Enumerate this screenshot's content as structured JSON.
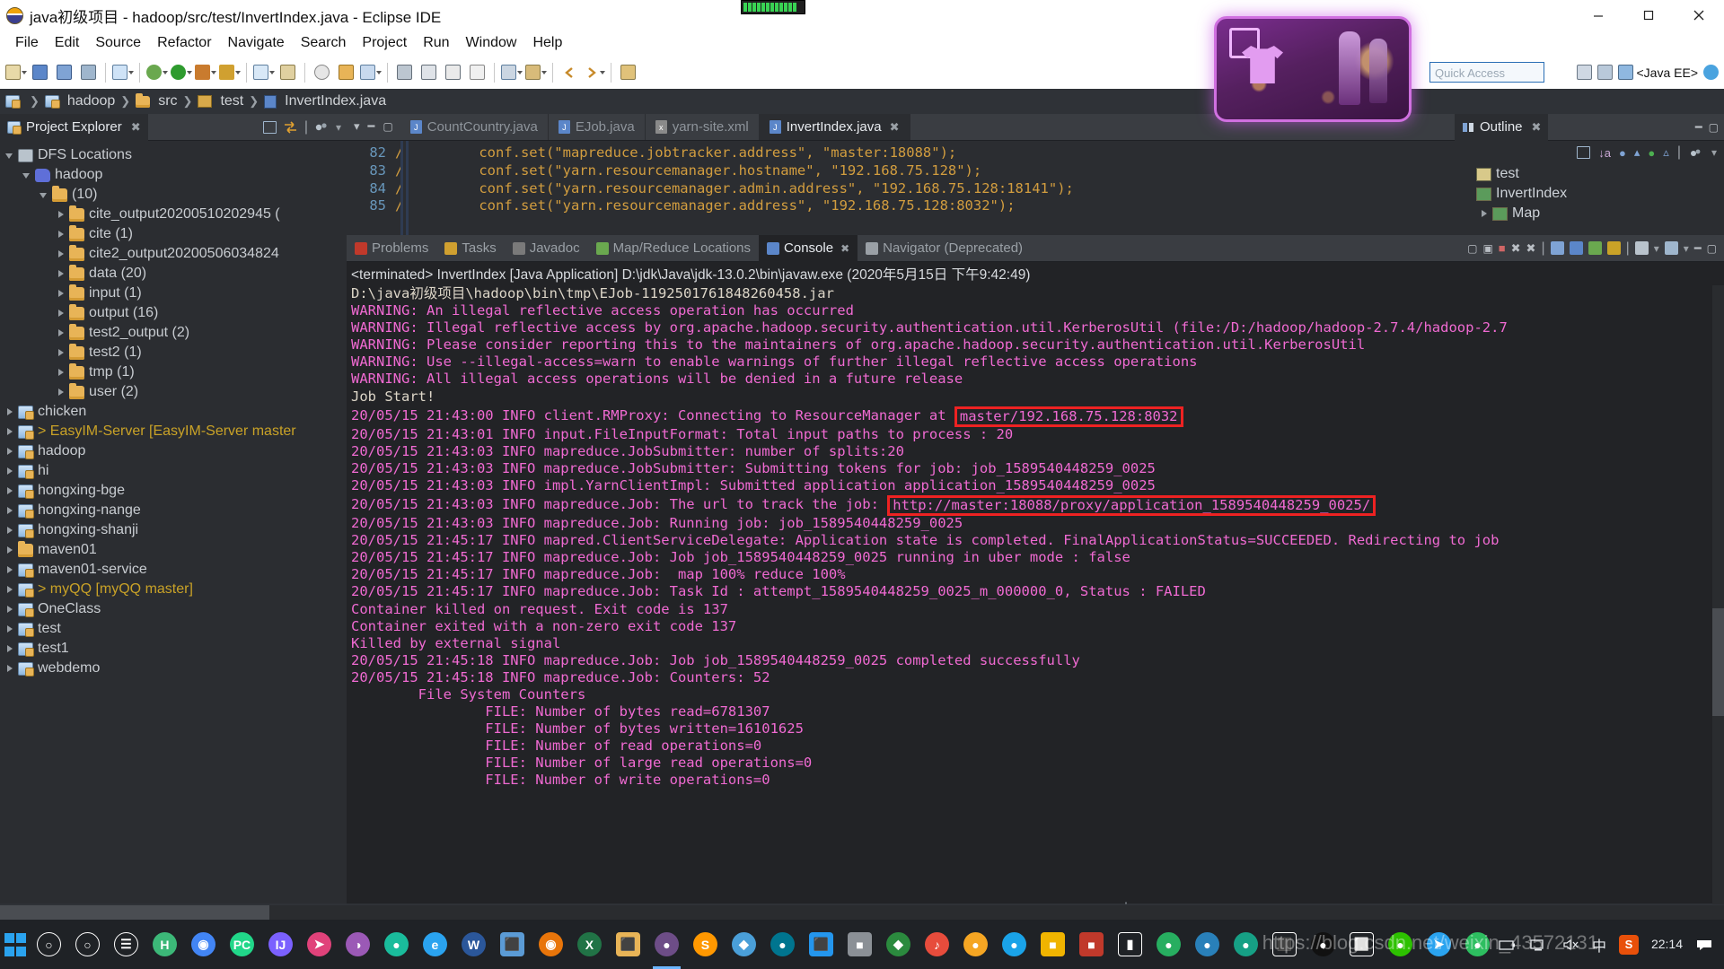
{
  "window": {
    "title": "java初级项目 - hadoop/src/test/InvertIndex.java - Eclipse IDE",
    "app_icon": "eclipse-icon",
    "minimize": "—",
    "maximize": "❐",
    "close": "✕"
  },
  "menubar": {
    "items": [
      "File",
      "Edit",
      "Source",
      "Refactor",
      "Navigate",
      "Search",
      "Project",
      "Run",
      "Window",
      "Help"
    ]
  },
  "toolbar": {
    "quick_access_placeholder": "Quick Access",
    "perspective_label": "<Java EE>"
  },
  "breadcrumb": {
    "items": [
      "hadoop",
      "src",
      "test",
      "InvertIndex.java"
    ]
  },
  "project_explorer": {
    "tab_label": "Project Explorer",
    "tree": [
      {
        "label": "DFS Locations",
        "indent": 0,
        "arrow": "open",
        "icon": "dfs-icon",
        "style": "folder"
      },
      {
        "label": "hadoop",
        "indent": 1,
        "arrow": "open",
        "icon": "elephant-icon",
        "style": "folder"
      },
      {
        "label": "(10)",
        "indent": 2,
        "arrow": "open",
        "icon": "folder-icon",
        "style": "folder"
      },
      {
        "label": "cite_output20200510202945 (",
        "indent": 3,
        "arrow": "closed",
        "icon": "folder-icon",
        "style": "folder"
      },
      {
        "label": "cite (1)",
        "indent": 3,
        "arrow": "closed",
        "icon": "folder-icon",
        "style": "folder"
      },
      {
        "label": "cite2_output20200506034824",
        "indent": 3,
        "arrow": "closed",
        "icon": "folder-icon",
        "style": "folder"
      },
      {
        "label": "data (20)",
        "indent": 3,
        "arrow": "closed",
        "icon": "folder-icon",
        "style": "folder"
      },
      {
        "label": "input (1)",
        "indent": 3,
        "arrow": "closed",
        "icon": "folder-icon",
        "style": "folder"
      },
      {
        "label": "output (16)",
        "indent": 3,
        "arrow": "closed",
        "icon": "folder-icon",
        "style": "folder"
      },
      {
        "label": "test2_output (2)",
        "indent": 3,
        "arrow": "closed",
        "icon": "folder-icon",
        "style": "folder"
      },
      {
        "label": "test2 (1)",
        "indent": 3,
        "arrow": "closed",
        "icon": "folder-icon",
        "style": "folder"
      },
      {
        "label": "tmp (1)",
        "indent": 3,
        "arrow": "closed",
        "icon": "folder-icon",
        "style": "folder"
      },
      {
        "label": "user (2)",
        "indent": 3,
        "arrow": "closed",
        "icon": "folder-icon",
        "style": "folder"
      },
      {
        "label": "chicken",
        "indent": 0,
        "arrow": "closed",
        "icon": "java-project-icon",
        "style": "project"
      },
      {
        "label": "> EasyIM-Server [EasyIM-Server master",
        "indent": 0,
        "arrow": "closed",
        "icon": "java-project-icon",
        "style": "branch"
      },
      {
        "label": "hadoop",
        "indent": 0,
        "arrow": "closed",
        "icon": "java-project-icon",
        "style": "project"
      },
      {
        "label": "hi",
        "indent": 0,
        "arrow": "closed",
        "icon": "java-project-icon",
        "style": "project"
      },
      {
        "label": "hongxing-bge",
        "indent": 0,
        "arrow": "closed",
        "icon": "java-project-icon",
        "style": "project"
      },
      {
        "label": "hongxing-nange",
        "indent": 0,
        "arrow": "closed",
        "icon": "java-project-icon",
        "style": "project"
      },
      {
        "label": "hongxing-shanji",
        "indent": 0,
        "arrow": "closed",
        "icon": "java-project-icon",
        "style": "project"
      },
      {
        "label": "maven01",
        "indent": 0,
        "arrow": "closed",
        "icon": "folder-icon",
        "style": "folder"
      },
      {
        "label": "maven01-service",
        "indent": 0,
        "arrow": "closed",
        "icon": "java-project-icon",
        "style": "project"
      },
      {
        "label": "> myQQ [myQQ master]",
        "indent": 0,
        "arrow": "closed",
        "icon": "java-project-icon",
        "style": "branch"
      },
      {
        "label": "OneClass",
        "indent": 0,
        "arrow": "closed",
        "icon": "java-project-icon",
        "style": "project"
      },
      {
        "label": "test",
        "indent": 0,
        "arrow": "closed",
        "icon": "java-project-icon",
        "style": "project"
      },
      {
        "label": "test1",
        "indent": 0,
        "arrow": "closed",
        "icon": "java-project-icon",
        "style": "project"
      },
      {
        "label": "webdemo",
        "indent": 0,
        "arrow": "closed",
        "icon": "java-project-icon",
        "style": "project"
      }
    ]
  },
  "editor": {
    "tabs": [
      {
        "label": "CountCountry.java",
        "icon": "java-file-icon",
        "active": false
      },
      {
        "label": "EJob.java",
        "icon": "java-file-icon",
        "active": false
      },
      {
        "label": "yarn-site.xml",
        "icon": "xml-file-icon",
        "active": false
      },
      {
        "label": "InvertIndex.java",
        "icon": "java-file-icon",
        "active": true
      }
    ],
    "lines": [
      {
        "no": "82",
        "text": "//        conf.set(\"mapreduce.jobtracker.address\", \"master:18088\");"
      },
      {
        "no": "83",
        "text": "//        conf.set(\"yarn.resourcemanager.hostname\", \"192.168.75.128\");"
      },
      {
        "no": "84",
        "text": "//        conf.set(\"yarn.resourcemanager.admin.address\", \"192.168.75.128:18141\");"
      },
      {
        "no": "85",
        "text": "//        conf.set(\"yarn.resourcemanager.address\", \"192.168.75.128:8032\");"
      }
    ]
  },
  "outline": {
    "tab_label": "Outline",
    "items": [
      {
        "label": "test",
        "indent": 0,
        "arrow": "none",
        "icon": "package-icon"
      },
      {
        "label": "InvertIndex",
        "indent": 0,
        "arrow": "none",
        "icon": "class-icon"
      },
      {
        "label": "Map",
        "indent": 1,
        "arrow": "closed",
        "icon": "class-icon"
      }
    ]
  },
  "console": {
    "tabs": [
      {
        "label": "Problems",
        "icon": "problems-icon",
        "active": false
      },
      {
        "label": "Tasks",
        "icon": "tasks-icon",
        "active": false
      },
      {
        "label": "Javadoc",
        "icon": "javadoc-icon",
        "active": false
      },
      {
        "label": "Map/Reduce Locations",
        "icon": "mapreduce-icon",
        "active": false
      },
      {
        "label": "Console",
        "icon": "console-icon",
        "active": true
      },
      {
        "label": "Navigator (Deprecated)",
        "icon": "navigator-icon",
        "active": false
      }
    ],
    "launch_line": "<terminated> InvertIndex [Java Application] D:\\jdk\\Java\\jdk-13.0.2\\bin\\javaw.exe (2020年5月15日 下午9:42:49)",
    "lines": [
      {
        "text": "D:\\java初级项目\\hadoop\\bin\\tmp\\EJob-1192501761848260458.jar",
        "style": "white"
      },
      {
        "text": "WARNING: An illegal reflective access operation has occurred",
        "style": "warn"
      },
      {
        "text": "WARNING: Illegal reflective access by org.apache.hadoop.security.authentication.util.KerberosUtil (file:/D:/hadoop/hadoop-2.7.4/hadoop-2.7",
        "style": "warn"
      },
      {
        "text": "WARNING: Please consider reporting this to the maintainers of org.apache.hadoop.security.authentication.util.KerberosUtil",
        "style": "warn"
      },
      {
        "text": "WARNING: Use --illegal-access=warn to enable warnings of further illegal reflective access operations",
        "style": "warn"
      },
      {
        "text": "WARNING: All illegal access operations will be denied in a future release",
        "style": "warn"
      },
      {
        "text": "Job Start!",
        "style": "white"
      },
      {
        "text": "20/05/15 21:43:00 INFO client.RMProxy: Connecting to ResourceManager at ",
        "style": "info",
        "highlight": "master/192.168.75.128:8032"
      },
      {
        "text": "20/05/15 21:43:01 INFO input.FileInputFormat: Total input paths to process : 20",
        "style": "info"
      },
      {
        "text": "20/05/15 21:43:03 INFO mapreduce.JobSubmitter: number of splits:20",
        "style": "info"
      },
      {
        "text": "20/05/15 21:43:03 INFO mapreduce.JobSubmitter: Submitting tokens for job: job_1589540448259_0025",
        "style": "info"
      },
      {
        "text": "20/05/15 21:43:03 INFO impl.YarnClientImpl: Submitted application application_1589540448259_0025",
        "style": "info"
      },
      {
        "text": "20/05/15 21:43:03 INFO mapreduce.Job: The url to track the job: ",
        "style": "info",
        "highlight": "http://master:18088/proxy/application_1589540448259_0025/"
      },
      {
        "text": "20/05/15 21:43:03 INFO mapreduce.Job: Running job: job_1589540448259_0025",
        "style": "info"
      },
      {
        "text": "20/05/15 21:45:17 INFO mapred.ClientServiceDelegate: Application state is completed. FinalApplicationStatus=SUCCEEDED. Redirecting to job",
        "style": "info"
      },
      {
        "text": "20/05/15 21:45:17 INFO mapreduce.Job: Job job_1589540448259_0025 running in uber mode : false",
        "style": "info"
      },
      {
        "text": "20/05/15 21:45:17 INFO mapreduce.Job:  map 100% reduce 100%",
        "style": "info"
      },
      {
        "text": "20/05/15 21:45:17 INFO mapreduce.Job: Task Id : attempt_1589540448259_0025_m_000000_0, Status : FAILED",
        "style": "info"
      },
      {
        "text": "Container killed on request. Exit code is 137",
        "style": "info"
      },
      {
        "text": "Container exited with a non-zero exit code 137",
        "style": "info"
      },
      {
        "text": "Killed by external signal",
        "style": "info"
      },
      {
        "text": "",
        "style": "info"
      },
      {
        "text": "20/05/15 21:45:18 INFO mapreduce.Job: Job job_1589540448259_0025 completed successfully",
        "style": "info"
      },
      {
        "text": "20/05/15 21:45:18 INFO mapreduce.Job: Counters: 52",
        "style": "info"
      },
      {
        "text": "        File System Counters",
        "style": "info"
      },
      {
        "text": "                FILE: Number of bytes read=6781307",
        "style": "info"
      },
      {
        "text": "                FILE: Number of bytes written=16101625",
        "style": "info"
      },
      {
        "text": "                FILE: Number of read operations=0",
        "style": "info"
      },
      {
        "text": "                FILE: Number of large read operations=0",
        "style": "info"
      },
      {
        "text": "                FILE: Number of write operations=0",
        "style": "info"
      }
    ]
  },
  "taskbar": {
    "items": [
      {
        "name": "start-button",
        "glyph": "",
        "color": "#2aa3ef"
      },
      {
        "name": "search-icon",
        "glyph": "○",
        "color": "#ffffff"
      },
      {
        "name": "cortana-icon",
        "glyph": "○",
        "color": "#ffffff"
      },
      {
        "name": "task-view-icon",
        "glyph": "☰",
        "color": "#ffffff"
      },
      {
        "name": "hbuilder-icon",
        "glyph": "H",
        "color": "#3cb878"
      },
      {
        "name": "chrome-icon",
        "glyph": "◉",
        "color": "#4285f4"
      },
      {
        "name": "pycharm-icon",
        "glyph": "PC",
        "color": "#21d789"
      },
      {
        "name": "idea-icon",
        "glyph": "IJ",
        "color": "#7b61ff"
      },
      {
        "name": "cursor-icon",
        "glyph": "➤",
        "color": "#e0427a"
      },
      {
        "name": "paint-icon",
        "glyph": "◑",
        "color": "#9b59b6"
      },
      {
        "name": "app-green-icon",
        "glyph": "●",
        "color": "#1abc9c"
      },
      {
        "name": "edge-icon",
        "glyph": "e",
        "color": "#2aa3ef"
      },
      {
        "name": "word-icon",
        "glyph": "W",
        "color": "#2b579a"
      },
      {
        "name": "explorer-icon",
        "glyph": "⬛",
        "color": "#5b9bd5"
      },
      {
        "name": "firefox-icon",
        "glyph": "◉",
        "color": "#e8750a"
      },
      {
        "name": "excel-icon",
        "glyph": "X",
        "color": "#217346"
      },
      {
        "name": "folder-icon",
        "glyph": "⬛",
        "color": "#e8b457"
      },
      {
        "name": "eclipse-icon",
        "glyph": "●",
        "color": "#6d4d87"
      },
      {
        "name": "sublime-icon",
        "glyph": "S",
        "color": "#ff9800"
      },
      {
        "name": "vm-icon",
        "glyph": "◆",
        "color": "#4a9fd8"
      },
      {
        "name": "mysql-icon",
        "glyph": "●",
        "color": "#00758f"
      },
      {
        "name": "docker-icon",
        "glyph": "⬛",
        "color": "#2496ed"
      },
      {
        "name": "app2-icon",
        "glyph": "■",
        "color": "#8b9096"
      },
      {
        "name": "navicat-icon",
        "glyph": "◆",
        "color": "#2b8a3e"
      },
      {
        "name": "music-icon",
        "glyph": "♪",
        "color": "#e74c3c"
      },
      {
        "name": "app3-icon",
        "glyph": "●",
        "color": "#f5a623"
      },
      {
        "name": "app4-icon",
        "glyph": "●",
        "color": "#1aa3e8"
      },
      {
        "name": "app5-icon",
        "glyph": "■",
        "color": "#f0b400"
      },
      {
        "name": "app6-icon",
        "glyph": "■",
        "color": "#c0392b"
      },
      {
        "name": "battery-app-icon",
        "glyph": "▮",
        "color": "#bdc3c7"
      },
      {
        "name": "app7-icon",
        "glyph": "●",
        "color": "#27ae60"
      },
      {
        "name": "app8-icon",
        "glyph": "●",
        "color": "#2980b9"
      },
      {
        "name": "app9-icon",
        "glyph": "●",
        "color": "#16a085"
      },
      {
        "name": "terminal-icon",
        "glyph": "⬛",
        "color": "#dddddd"
      },
      {
        "name": "qq-icon",
        "glyph": "●",
        "color": "#111111"
      },
      {
        "name": "usb-icon",
        "glyph": "⬜",
        "color": "#ffffff"
      },
      {
        "name": "wechat-icon",
        "glyph": "●",
        "color": "#2dc100"
      },
      {
        "name": "telegram-icon",
        "glyph": "➤",
        "color": "#2aa3ef"
      },
      {
        "name": "evernote-icon",
        "glyph": "●",
        "color": "#2dbe60"
      }
    ],
    "tray": {
      "battery_icon": "battery-icon",
      "network_icon": "network-icon",
      "volume_icon": "volume-icon",
      "ime_label": "中",
      "sogou_icon": "sogou-icon",
      "time": "22:14",
      "notification_icon": "notification-icon"
    },
    "watermark": "https://blog.csdn.net/weixin_43572131"
  }
}
